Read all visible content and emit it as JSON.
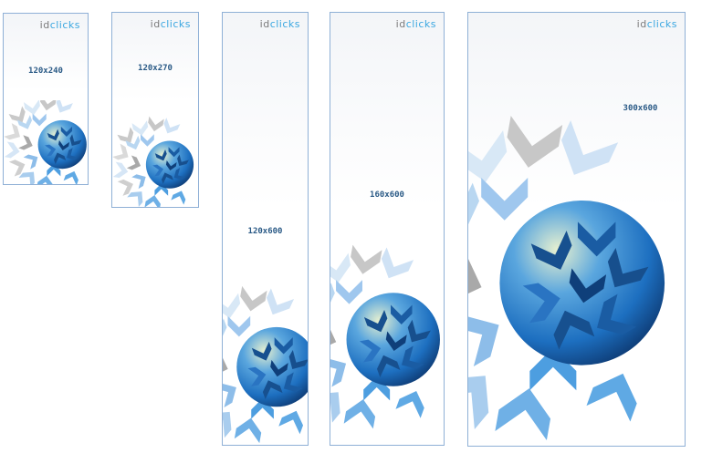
{
  "logo": {
    "part1": "id",
    "part2": "clicks"
  },
  "banners": [
    {
      "size_label": "120x240"
    },
    {
      "size_label": "120x270"
    },
    {
      "size_label": "120x600"
    },
    {
      "size_label": "160x600"
    },
    {
      "size_label": "300x600"
    }
  ],
  "colors": {
    "border": "#8fb0d6",
    "accent": "#3aa7e0",
    "globe": "#1d6fc0",
    "label": "#2a5a86"
  }
}
